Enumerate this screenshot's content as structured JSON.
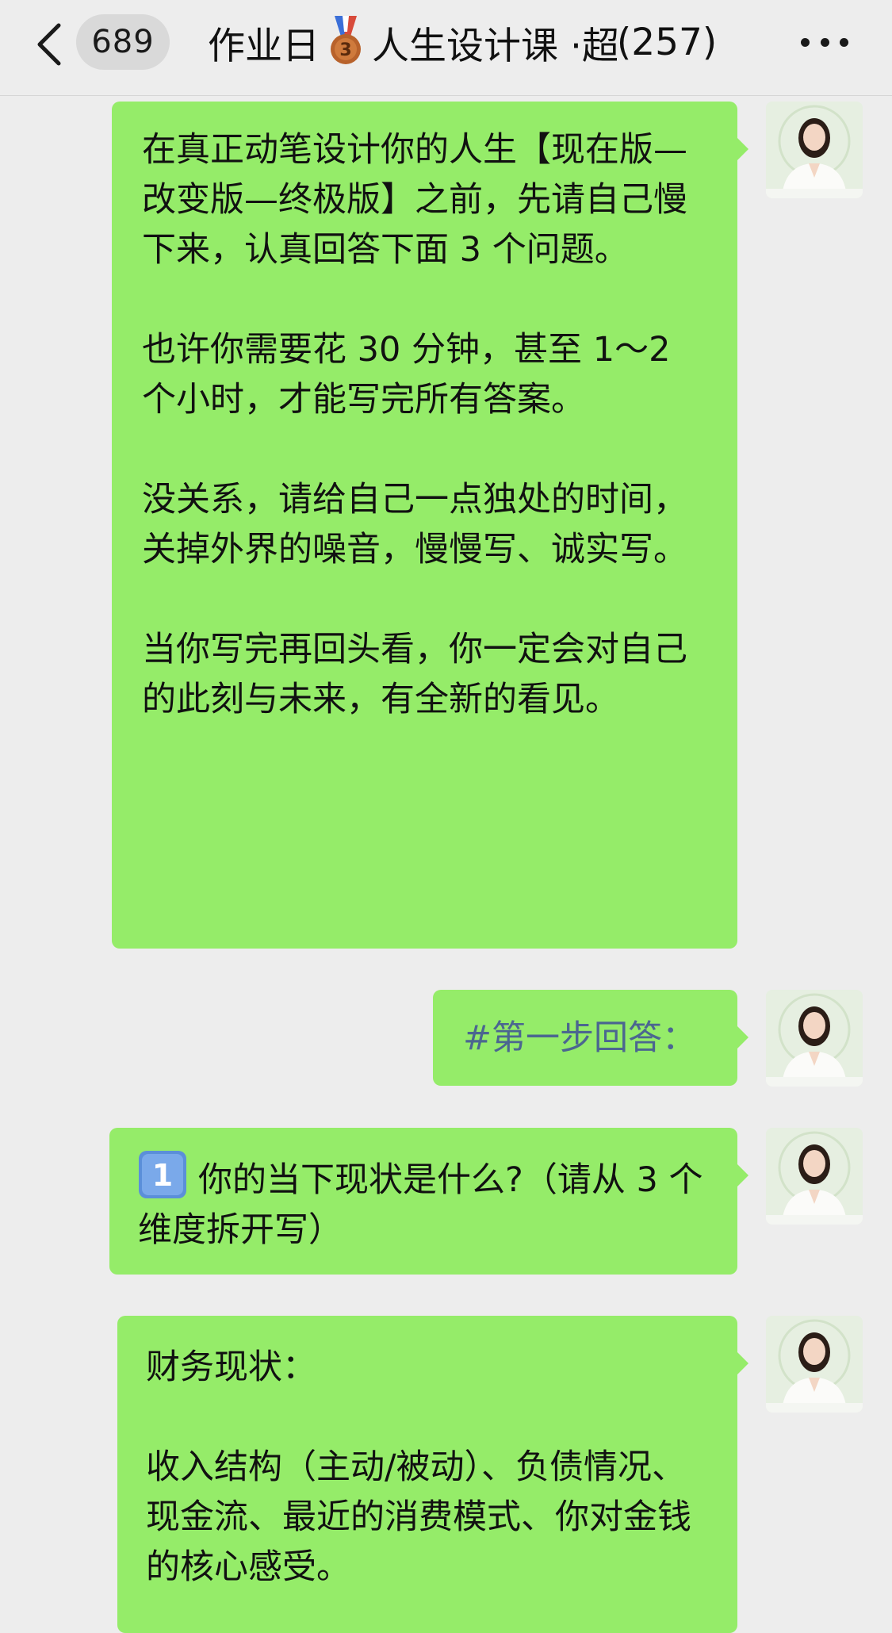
{
  "header": {
    "unread_count": "689",
    "title_prefix": "作业日",
    "medal_icon": "third-place-medal-icon",
    "title_main": "人生设计课 · ",
    "title_clipped": "超",
    "member_count": "(257)"
  },
  "messages": [
    {
      "paragraphs": [
        "在真正动笔设计你的人生【现在版—改变版—终极版】之前，先请自己慢下来，认真回答下面 3 个问题。",
        "也许你需要花 30 分钟，甚至 1～2 个小时，才能写完所有答案。",
        "没关系，请给自己一点独处的时间，关掉外界的噪音，慢慢写、诚实写。",
        "当你写完再回头看，你一定会对自己的此刻与未来，有全新的看见。"
      ]
    },
    {
      "tag": "#第一步回答："
    },
    {
      "keycap_icon": "keycap-digit-one-icon",
      "text": "你的当下现状是什么?（请从 3 个维度拆开写）"
    },
    {
      "paragraphs": [
        "财务现状：",
        "收入结构（主动/被动）、负债情况、现金流、最近的消费模式、你对金钱的核心感受。"
      ]
    }
  ],
  "colors": {
    "background": "#ededed",
    "bubble": "#95ec69",
    "tag_text": "#4b6690"
  }
}
